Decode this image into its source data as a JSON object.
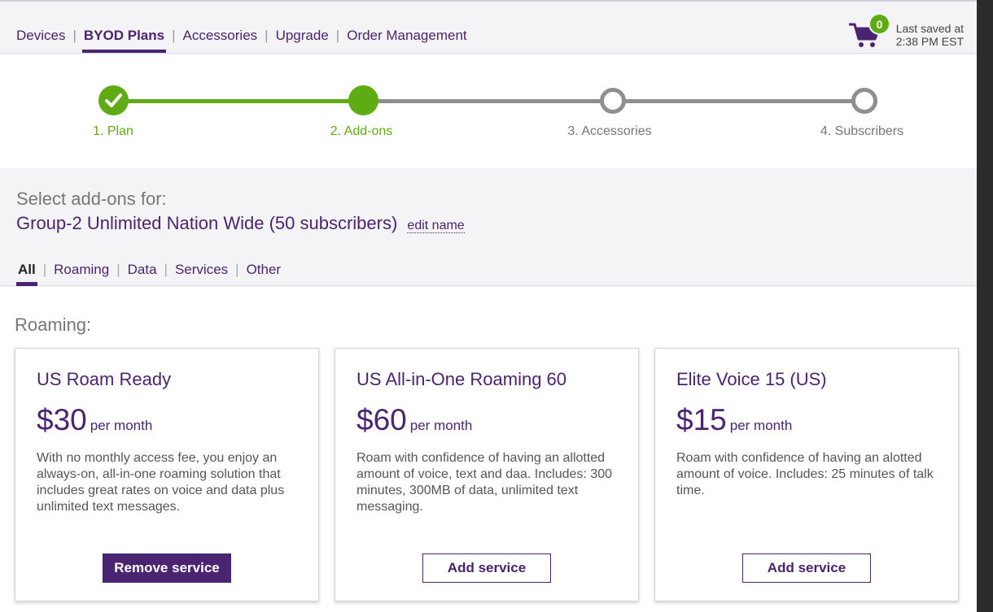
{
  "nav": {
    "items": [
      {
        "label": "Devices"
      },
      {
        "label": "BYOD Plans",
        "active": true
      },
      {
        "label": "Accessories"
      },
      {
        "label": "Upgrade"
      },
      {
        "label": "Order Management"
      }
    ]
  },
  "cart": {
    "count": "0",
    "icon": "shopping-cart-icon"
  },
  "saved": {
    "line1": "Last saved at",
    "line2": "2:38 PM EST"
  },
  "steps": [
    {
      "label": "1. Plan",
      "state": "complete"
    },
    {
      "label": "2. Add-ons",
      "state": "current"
    },
    {
      "label": "3. Accessories",
      "state": "pending"
    },
    {
      "label": "4. Subscribers",
      "state": "pending"
    }
  ],
  "select": {
    "heading": "Select add-ons for:",
    "group_name": "Group-2 Unlimited Nation Wide (50 subscribers)",
    "edit_label": "edit name"
  },
  "filters": [
    {
      "label": "All",
      "active": true
    },
    {
      "label": "Roaming"
    },
    {
      "label": "Data"
    },
    {
      "label": "Services"
    },
    {
      "label": "Other"
    }
  ],
  "roaming": {
    "title": "Roaming:",
    "cards": [
      {
        "title": "US Roam Ready",
        "price": "$30",
        "per": "per month",
        "description": "With no monthly access fee, you enjoy an always-on, all-in-one roaming solution that includes great rates on voice and data plus unlimited text messages.",
        "button": "Remove service"
      },
      {
        "title": "US All-in-One Roaming 60",
        "price": "$60",
        "per": "per month",
        "description": "Roam with confidence of having an allotted amount of voice, text and daa. Includes: 300 minutes, 300MB of data, unlimited text messaging.",
        "button": "Add service"
      },
      {
        "title": "Elite Voice 15 (US)",
        "price": "$15",
        "per": "per month",
        "description": "Roam with confidence of having an alotted amount of voice. Includes: 25 minutes of talk time.",
        "button": "Add service"
      }
    ]
  },
  "colors": {
    "brand_purple": "#4a2470",
    "progress_green": "#5fab13",
    "inactive_gray": "#8f8f8f"
  }
}
